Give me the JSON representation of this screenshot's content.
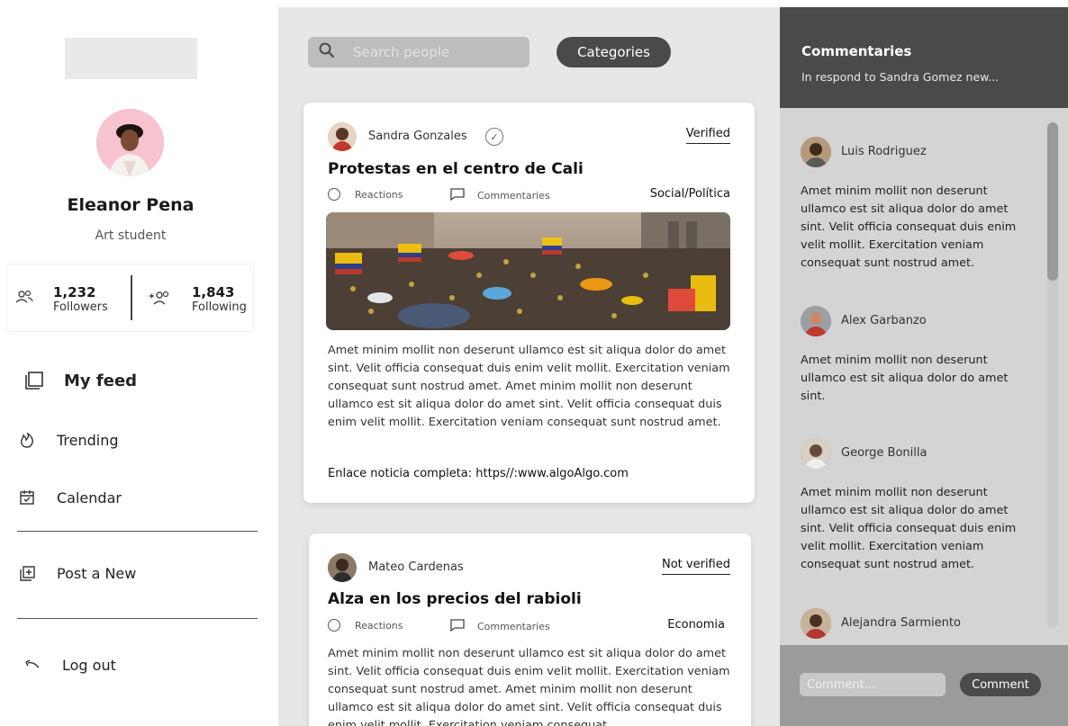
{
  "profile": {
    "name": "Eleanor Pena",
    "role": "Art student",
    "followers_count": "1,232",
    "followers_label": "Followers",
    "following_count": "1,843",
    "following_label": "Following"
  },
  "nav": {
    "my_feed": "My feed",
    "trending": "Trending",
    "calendar": "Calendar",
    "post_new": "Post a New",
    "log_out": "Log out"
  },
  "feed": {
    "search_placeholder": "Search people",
    "categories_label": "Categories",
    "posts": [
      {
        "author": "Sandra Gonzales",
        "status": "Verified",
        "title": "Protestas en el centro de Cali",
        "reactions_label": "Reactions",
        "comments_label": "Commentaries",
        "category": "Social/Política",
        "body": "Amet minim mollit non deserunt ullamco est sit aliqua dolor do amet sint. Velit officia consequat duis enim velit mollit. Exercitation veniam consequat sunt nostrud amet. Amet minim mollit non deserunt ullamco est sit aliqua dolor do amet sint. Velit officia consequat duis enim velit mollit. Exercitation veniam consequat sunt nostrud amet.",
        "link": "Enlace noticia completa: https//:www.algoAlgo.com"
      },
      {
        "author": "Mateo Cardenas",
        "status": "Not verified",
        "title": "Alza en los precios del rabioli",
        "reactions_label": "Reactions",
        "comments_label": "Commentaries",
        "category": "Economia",
        "body": "Amet minim mollit non deserunt ullamco est sit aliqua dolor do amet sint. Velit officia consequat duis enim velit mollit. Exercitation veniam consequat sunt nostrud amet. Amet minim mollit non deserunt ullamco est sit aliqua dolor do amet sint. Velit officia consequat duis enim velit mollit. Exercitation veniam consequat"
      }
    ]
  },
  "commentaries": {
    "title": "Commentaries",
    "subtitle": "In respond to Sandra Gomez new...",
    "items": [
      {
        "author": "Luis Rodriguez",
        "text": "Amet minim mollit non deserunt ullamco est sit aliqua dolor do amet sint. Velit officia consequat duis enim velit mollit. Exercitation veniam consequat sunt nostrud amet."
      },
      {
        "author": "Alex  Garbanzo",
        "text": "Amet minim mollit non deserunt ullamco est sit aliqua dolor do amet sint."
      },
      {
        "author": "George Bonilla",
        "text": "Amet minim mollit non deserunt ullamco est sit aliqua dolor do amet sint. Velit officia consequat duis enim velit mollit. Exercitation veniam consequat sunt nostrud amet."
      },
      {
        "author": "Alejandra Sarmiento",
        "text": ""
      }
    ],
    "input_placeholder": "Comment...",
    "submit_label": "Comment"
  },
  "icons": {
    "followers": "followers-icon",
    "following": "add-user-icon",
    "my_feed": "feed-icon",
    "trending": "flame-icon",
    "calendar": "calendar-icon",
    "post_new": "add-post-icon",
    "log_out": "undo-arrow-icon",
    "search": "search-icon",
    "reactions": "circle-icon",
    "comments": "comment-bubble-icon",
    "verified": "check-circle-icon"
  },
  "colors": {
    "dark_accent": "#4a4a4a",
    "feed_bg": "#e7e7e7",
    "panel_bg": "#d4d4d4"
  }
}
